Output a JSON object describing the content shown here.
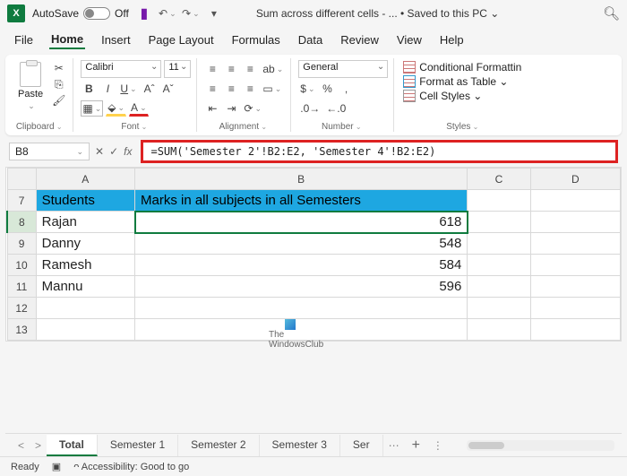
{
  "titlebar": {
    "autosave_label": "AutoSave",
    "autosave_state": "Off",
    "doc_title": "Sum across different cells - ... • Saved to this PC ⌄"
  },
  "menu": [
    "File",
    "Home",
    "Insert",
    "Page Layout",
    "Formulas",
    "Data",
    "Review",
    "View",
    "Help"
  ],
  "active_menu": "Home",
  "ribbon": {
    "clipboard": {
      "label": "Clipboard",
      "paste": "Paste"
    },
    "font": {
      "label": "Font",
      "name": "Calibri",
      "size": "11"
    },
    "alignment": {
      "label": "Alignment"
    },
    "number": {
      "label": "Number",
      "format": "General"
    },
    "styles": {
      "label": "Styles",
      "cond": "Conditional Formattin",
      "table": "Format as Table ⌄",
      "cell": "Cell Styles ⌄"
    }
  },
  "formula": {
    "namebox": "B8",
    "value": "=SUM('Semester 2'!B2:E2, 'Semester 4'!B2:E2)"
  },
  "columns": [
    "A",
    "B",
    "C",
    "D"
  ],
  "rows": [
    {
      "n": 7,
      "a": "Students",
      "b": "Marks in all subjects in all Semesters",
      "header": true
    },
    {
      "n": 8,
      "a": "Rajan",
      "b": "618",
      "selected": true
    },
    {
      "n": 9,
      "a": "Danny",
      "b": "548"
    },
    {
      "n": 10,
      "a": "Ramesh",
      "b": "584"
    },
    {
      "n": 11,
      "a": "Mannu",
      "b": "596"
    },
    {
      "n": 12,
      "a": "",
      "b": ""
    },
    {
      "n": 13,
      "a": "",
      "b": ""
    }
  ],
  "watermark": {
    "line1": "The",
    "line2": "WindowsClub"
  },
  "sheets": [
    "Total",
    "Semester 1",
    "Semester 2",
    "Semester 3",
    "Ser"
  ],
  "active_sheet": "Total",
  "status": {
    "ready": "Ready",
    "access": "Accessibility: Good to go"
  },
  "chart_data": {
    "type": "table",
    "title": "Marks in all subjects in all Semesters",
    "categories": [
      "Rajan",
      "Danny",
      "Ramesh",
      "Mannu"
    ],
    "values": [
      618,
      548,
      584,
      596
    ]
  }
}
